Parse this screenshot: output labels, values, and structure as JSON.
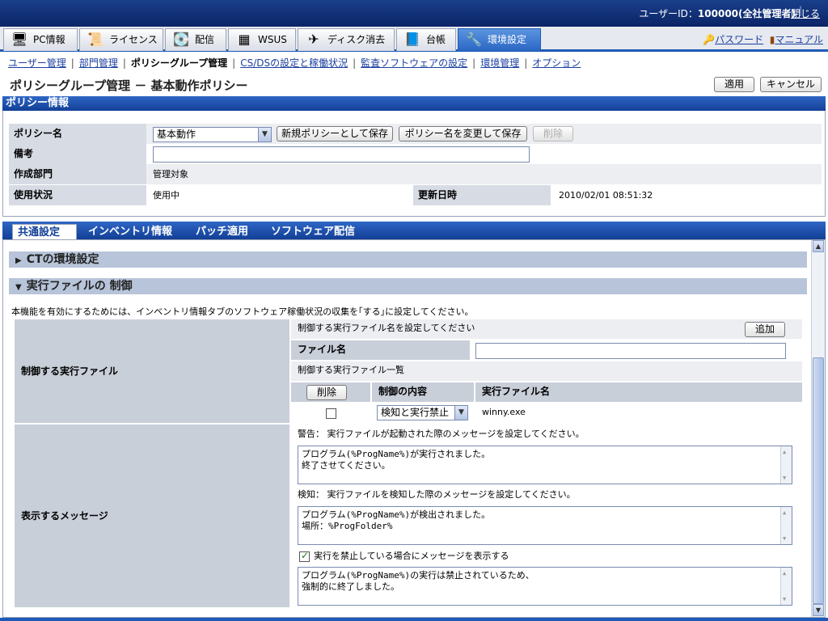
{
  "topbar": {
    "user_label": "ユーザーID：",
    "user_value": "100000(全社管理者)",
    "close_label": "閉じる"
  },
  "main_tabs": [
    {
      "label": "PC情報",
      "icon": "pc-icon"
    },
    {
      "label": "ライセンス",
      "icon": "license-icon"
    },
    {
      "label": "配信",
      "icon": "delivery-icon"
    },
    {
      "label": "WSUS",
      "icon": "wsus-icon"
    },
    {
      "label": "ディスク消去",
      "icon": "disk-erase-icon"
    },
    {
      "label": "台帳",
      "icon": "ledger-icon"
    },
    {
      "label": "環境設定",
      "icon": "settings-icon"
    }
  ],
  "top_links": {
    "password": "パスワード",
    "manual": "マニュアル"
  },
  "sub_nav": [
    "ユーザー管理",
    "部門管理",
    "ポリシーグループ管理",
    "CS/DSの設定と稼働状況",
    "監査ソフトウェアの設定",
    "環境管理",
    "オプション"
  ],
  "page": {
    "title": "ポリシーグループ管理 － 基本動作ポリシー",
    "apply": "適用",
    "cancel": "キャンセル"
  },
  "policy_info": {
    "section_title": "ポリシー情報",
    "name_label": "ポリシー名",
    "name_value": "基本動作",
    "save_new": "新規ポリシーとして保存",
    "rename_save": "ポリシー名を変更して保存",
    "delete": "削除",
    "remarks_label": "備考",
    "dept_label": "作成部門",
    "dept_value": "管理対象",
    "status_label": "使用状況",
    "status_value": "使用中",
    "updated_label": "更新日時",
    "updated_value": "2010/02/01 08:51:32"
  },
  "sub_tabs": [
    "共通設定",
    "インベントリ情報",
    "パッチ適用",
    "ソフトウェア配信"
  ],
  "sections": {
    "ct_env": "CTの環境設定",
    "exec_ctrl": "実行ファイルの 制御",
    "note": "本機能を有効にするためには、インベントリ情報タブのソフトウェア稼働状況の収集を｢する｣に設定してください。",
    "exec_label": "制御する実行ファイル",
    "exec_set_hint": "制御する実行ファイル名を設定してください",
    "add": "追加",
    "file_name_label": "ファイル名",
    "list_title": "制御する実行ファイル一覧",
    "delete": "削除",
    "col_control": "制御の内容",
    "col_exe": "実行ファイル名",
    "row_control": "検知と実行禁止",
    "row_exe": "winny.exe",
    "msg_label": "表示するメッセージ",
    "warn_hint": "警告：  実行ファイルが起動された際のメッセージを設定してください。",
    "warn_text": "プログラム(%ProgName%)が実行されました。\n終了させてください。",
    "detect_hint": "検知：  実行ファイルを検知した際のメッセージを設定してください。",
    "detect_text": "プログラム(%ProgName%)が検出されました。\n場所：%ProgFolder%",
    "block_check": "実行を禁止している場合にメッセージを表示する",
    "block_text": "プログラム(%ProgName%)の実行は禁止されているため、\n強制的に終了しました。"
  },
  "colors": {
    "accent": "#1d5ab8",
    "header": "#0b2466",
    "label_bg": "#d6dbe4"
  }
}
